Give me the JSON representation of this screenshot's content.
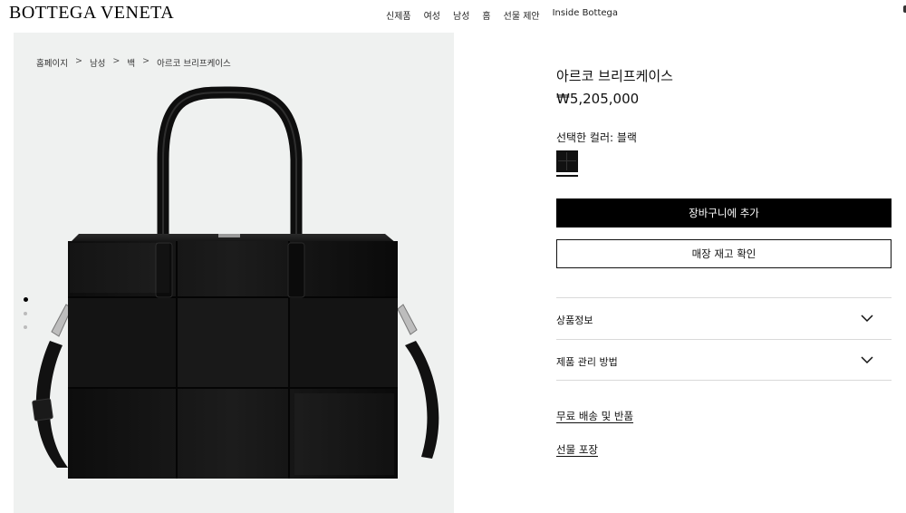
{
  "header": {
    "logo": "BOTTEGA VENETA",
    "nav": [
      "신제품",
      "여성",
      "남성",
      "홈",
      "선물 제안",
      "Inside Bottega"
    ]
  },
  "breadcrumb": [
    "홈페이지",
    "남성",
    "백",
    "아르코 브리프케이스"
  ],
  "breadcrumb_separator": ">",
  "gallery": {
    "image_count": 3,
    "active_index": 0
  },
  "product": {
    "title": "아르코 브리프케이스",
    "price": "₩5,205,000",
    "color_label": "선택한 컬러: 블랙",
    "swatch_color": "#111111"
  },
  "buttons": {
    "add_to_cart": "장바구니에 추가",
    "check_stock": "매장 재고 확인"
  },
  "accordion": [
    {
      "label": "상품정보",
      "icon": "chevron-down-icon"
    },
    {
      "label": "제품 관리 방법",
      "icon": "chevron-down-icon"
    }
  ],
  "links": {
    "shipping": "무료 배송 및 반품",
    "gift": "선물 포장"
  },
  "colors": {
    "accent": "#000000",
    "gallery_bg": "#eff1f0"
  }
}
